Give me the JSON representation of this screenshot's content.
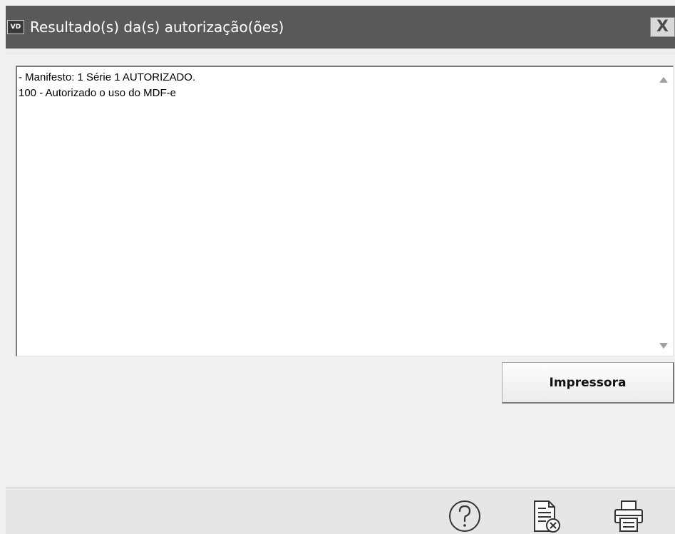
{
  "window": {
    "title": "Resultado(s) da(s) autorização(ões)",
    "app_icon_text": "VD",
    "close_label": "X"
  },
  "memo": {
    "lines": [
      "- Manifesto: 1 Série 1 AUTORIZADO.",
      "100 - Autorizado o uso do MDF-e"
    ]
  },
  "buttons": {
    "printer_label": "Impressora"
  },
  "toolbar": {
    "icons": [
      "help-icon",
      "document-cancel-icon",
      "printer-icon"
    ]
  }
}
